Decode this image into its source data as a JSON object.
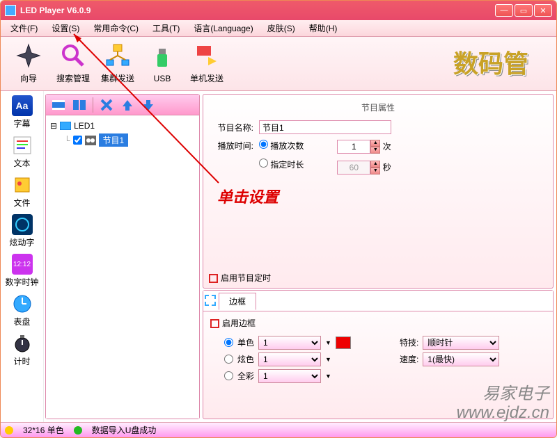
{
  "title": "LED Player V6.0.9",
  "menus": {
    "file": "文件(F)",
    "settings": "设置(S)",
    "commands": "常用命令(C)",
    "tools": "工具(T)",
    "language": "语言(Language)",
    "skin": "皮肤(S)",
    "help": "帮助(H)"
  },
  "toolbar": {
    "wizard": "向导",
    "search": "搜索管理",
    "cluster": "集群发送",
    "usb": "USB",
    "single": "单机发送",
    "brand": "数码管"
  },
  "sidebar": {
    "subtitle": "字幕",
    "text": "文本",
    "file": "文件",
    "anim": "炫动字",
    "clock": "数字时钟",
    "dial": "表盘",
    "timer": "计时"
  },
  "tree": {
    "root": "LED1",
    "child": "节目1"
  },
  "props": {
    "header": "节目属性",
    "name_label": "节目名称:",
    "name_value": "节目1",
    "time_label": "播放时间:",
    "opt_count": "播放次数",
    "count_value": "1",
    "count_unit": "次",
    "opt_duration": "指定时长",
    "duration_value": "60",
    "duration_unit": "秒",
    "timer_enable": "启用节目定时"
  },
  "border": {
    "tab": "边框",
    "enable": "启用边框",
    "single": "单色",
    "single_val": "1",
    "dazzle": "炫色",
    "dazzle_val": "1",
    "full": "全彩",
    "full_val": "1",
    "effect_label": "特技:",
    "effect_value": "顺时针",
    "speed_label": "速度:",
    "speed_value": "1(最快)"
  },
  "status": {
    "res": "32*16 单色",
    "msg": "数据导入U盘成功"
  },
  "annotation": "单击设置",
  "watermark": {
    "line1": "易家电子",
    "line2": "www.ejdz.cn"
  },
  "colors": {
    "red": "#e00",
    "green": "#2b2",
    "yellow": "#fc0",
    "blue": "#2a7de1"
  }
}
